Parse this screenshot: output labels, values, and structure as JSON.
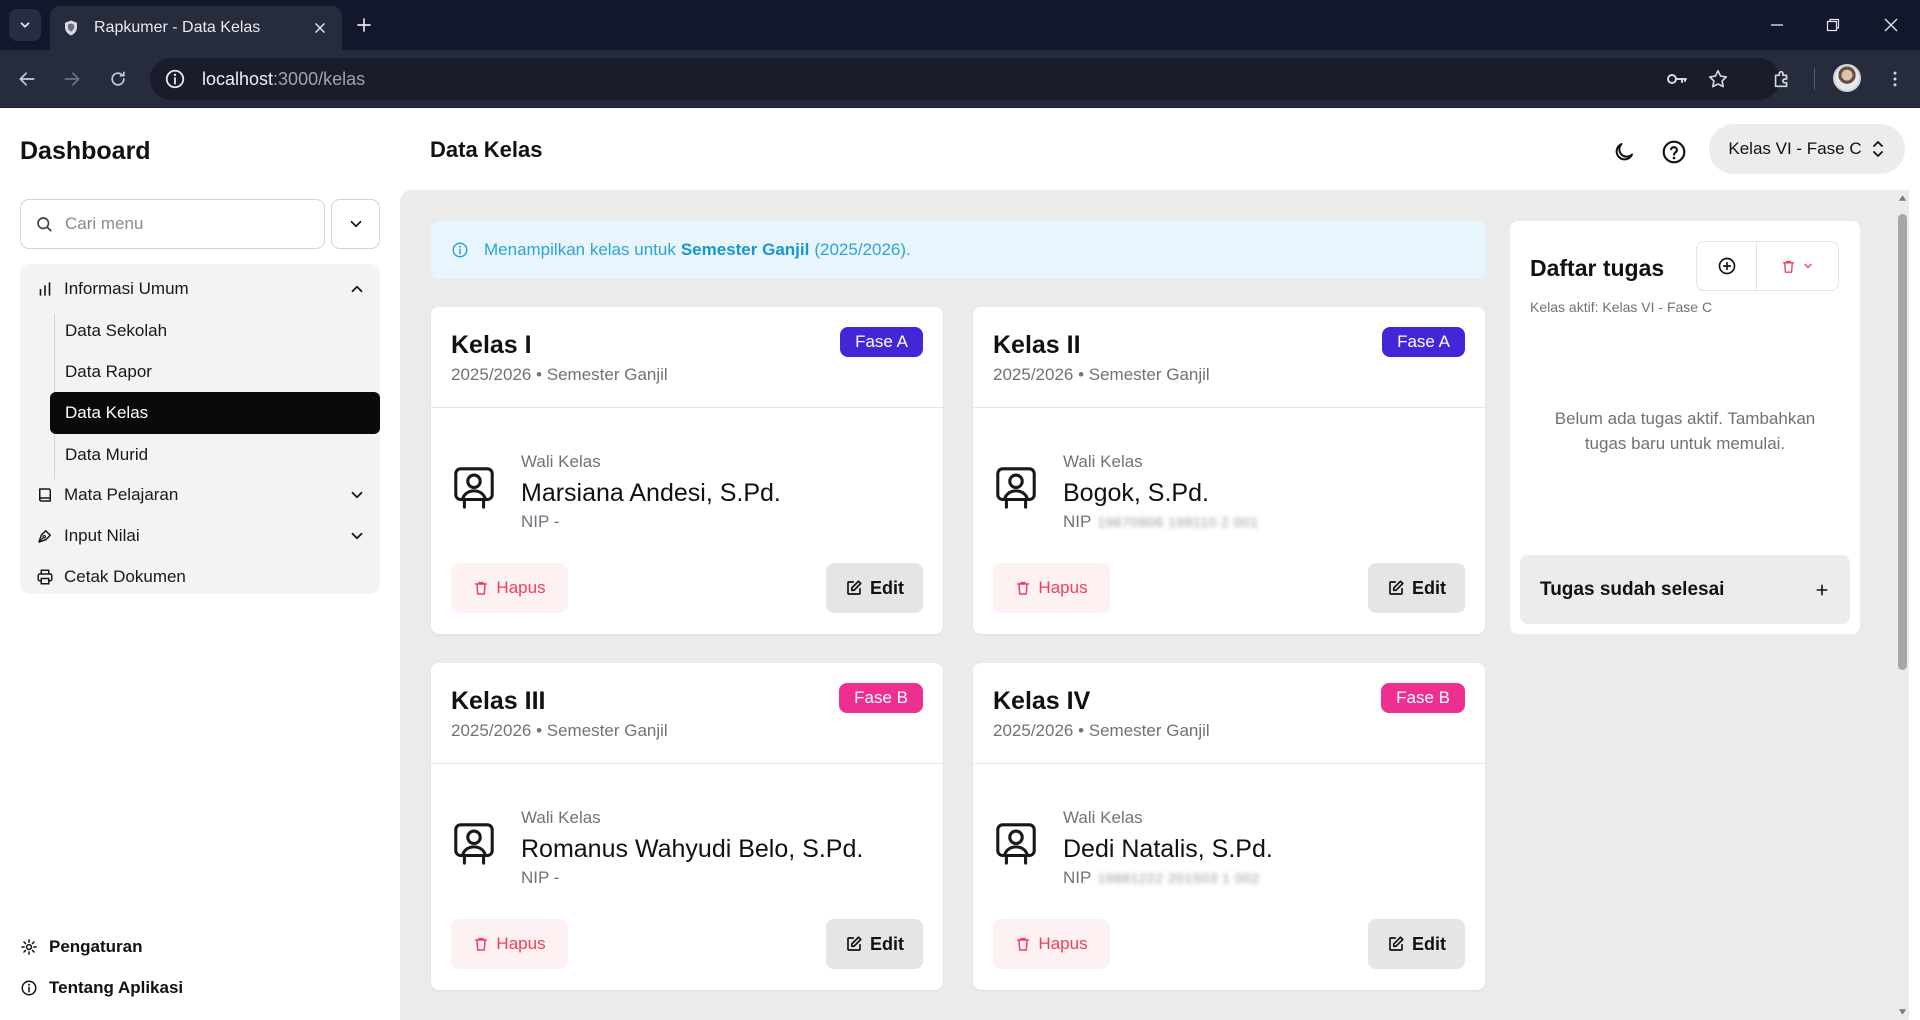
{
  "browser": {
    "tab_title": "Rapkumer - Data Kelas",
    "url_host": "localhost",
    "url_path": ":3000/kelas"
  },
  "sidebar": {
    "title": "Dashboard",
    "search_placeholder": "Cari menu",
    "menu": {
      "informasi_umum": "Informasi Umum",
      "sub_items": [
        "Data Sekolah",
        "Data Rapor",
        "Data Kelas",
        "Data Murid"
      ],
      "active_sub": "Data Kelas",
      "mata_pelajaran": "Mata Pelajaran",
      "input_nilai": "Input Nilai",
      "cetak_dokumen": "Cetak Dokumen"
    },
    "footer": {
      "pengaturan": "Pengaturan",
      "tentang": "Tentang Aplikasi"
    }
  },
  "header": {
    "page_title": "Data Kelas",
    "class_select": "Kelas VI - Fase C"
  },
  "banner": {
    "prefix": "Menampilkan kelas untuk",
    "semester": "Semester Ganjil",
    "suffix": "(2025/2026)."
  },
  "cards": [
    {
      "title": "Kelas I",
      "subtitle": "2025/2026 • Semester Ganjil",
      "badge": "Fase A",
      "wali_label": "Wali Kelas",
      "wali_name": "Marsiana Andesi, S.Pd.",
      "nip_label": "NIP",
      "nip_value": "-",
      "hapus": "Hapus",
      "edit": "Edit"
    },
    {
      "title": "Kelas II",
      "subtitle": "2025/2026 • Semester Ganjil",
      "badge": "Fase A",
      "wali_label": "Wali Kelas",
      "wali_name": "Bogok, S.Pd.",
      "nip_label": "NIP",
      "nip_value": "19670906 199110 2 001",
      "hapus": "Hapus",
      "edit": "Edit"
    },
    {
      "title": "Kelas III",
      "subtitle": "2025/2026 • Semester Ganjil",
      "badge": "Fase B",
      "wali_label": "Wali Kelas",
      "wali_name": "Romanus Wahyudi Belo, S.Pd.",
      "nip_label": "NIP",
      "nip_value": "-",
      "hapus": "Hapus",
      "edit": "Edit"
    },
    {
      "title": "Kelas IV",
      "subtitle": "2025/2026 • Semester Ganjil",
      "badge": "Fase B",
      "wali_label": "Wali Kelas",
      "wali_name": "Dedi Natalis, S.Pd.",
      "nip_label": "NIP",
      "nip_value": "19881222 201503 1 002",
      "hapus": "Hapus",
      "edit": "Edit"
    }
  ],
  "todo": {
    "title": "Daftar tugas",
    "subtitle": "Kelas aktif: Kelas VI - Fase C",
    "empty": "Belum ada tugas aktif. Tambahkan tugas baru untuk memulai.",
    "done": "Tugas sudah selesai"
  },
  "colors": {
    "fase_a": "#4526d6",
    "fase_b": "#ee2f8f",
    "danger": "#ef3f5c",
    "info": "#2aa5d8"
  }
}
